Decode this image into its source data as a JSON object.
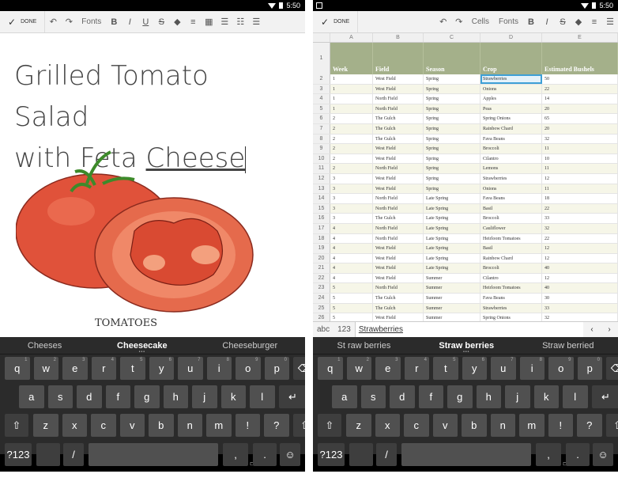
{
  "status_time": "5:50",
  "left": {
    "toolbar": {
      "done": "DONE",
      "fonts": "Fonts"
    },
    "doc_title_line1": "Grilled Tomato Salad",
    "doc_title_line2a": "with Feta ",
    "doc_title_line2b": "Cheese",
    "illus_label": "TOMATOES",
    "suggestions": [
      "Cheeses",
      "Cheesecake",
      "Cheeseburger"
    ]
  },
  "right": {
    "toolbar": {
      "done": "DONE",
      "cells": "Cells",
      "fonts": "Fonts"
    },
    "columns": [
      "A",
      "B",
      "C",
      "D",
      "E"
    ],
    "header_row": {
      "num": "1",
      "cells": [
        "Week",
        "Field",
        "Season",
        "Crop",
        "Estimated Bushels"
      ]
    },
    "rows": [
      [
        "2",
        "1",
        "West Field",
        "Spring",
        "Strawberries",
        "50"
      ],
      [
        "3",
        "1",
        "West Field",
        "Spring",
        "Onions",
        "22"
      ],
      [
        "4",
        "1",
        "North Field",
        "Spring",
        "Apples",
        "14"
      ],
      [
        "5",
        "1",
        "North Field",
        "Spring",
        "Peas",
        "20"
      ],
      [
        "6",
        "2",
        "The Gulch",
        "Spring",
        "Spring Onions",
        "65"
      ],
      [
        "7",
        "2",
        "The Gulch",
        "Spring",
        "Rainbow Chard",
        "20"
      ],
      [
        "8",
        "2",
        "The Gulch",
        "Spring",
        "Fava Beans",
        "32"
      ],
      [
        "9",
        "2",
        "West Field",
        "Spring",
        "Broccoli",
        "11"
      ],
      [
        "10",
        "2",
        "West Field",
        "Spring",
        "Cilantro",
        "10"
      ],
      [
        "11",
        "2",
        "North Field",
        "Spring",
        "Lemons",
        "11"
      ],
      [
        "12",
        "3",
        "West Field",
        "Spring",
        "Strawberries",
        "12"
      ],
      [
        "13",
        "3",
        "West Field",
        "Spring",
        "Onions",
        "11"
      ],
      [
        "14",
        "3",
        "North Field",
        "Late Spring",
        "Fava Beans",
        "18"
      ],
      [
        "15",
        "3",
        "North Field",
        "Late Spring",
        "Basil",
        "22"
      ],
      [
        "16",
        "3",
        "The Gulch",
        "Late Spring",
        "Broccoli",
        "33"
      ],
      [
        "17",
        "4",
        "North Field",
        "Late Spring",
        "Cauliflower",
        "32"
      ],
      [
        "18",
        "4",
        "North Field",
        "Late Spring",
        "Heirloom Tomatoes",
        "22"
      ],
      [
        "19",
        "4",
        "West Field",
        "Late Spring",
        "Basil",
        "12"
      ],
      [
        "20",
        "4",
        "West Field",
        "Late Spring",
        "Rainbow Chard",
        "12"
      ],
      [
        "21",
        "4",
        "West Field",
        "Late Spring",
        "Broccoli",
        "40"
      ],
      [
        "22",
        "4",
        "West Field",
        "Summer",
        "Cilantro",
        "12"
      ],
      [
        "23",
        "5",
        "North Field",
        "Summer",
        "Heirloom Tomatoes",
        "40"
      ],
      [
        "24",
        "5",
        "The Gulch",
        "Summer",
        "Fava Beans",
        "30"
      ],
      [
        "25",
        "5",
        "The Gulch",
        "Summer",
        "Strawberries",
        "33"
      ],
      [
        "26",
        "5",
        "West Field",
        "Summer",
        "Spring Onions",
        "32"
      ]
    ],
    "formula": {
      "abc": "abc",
      "num": "123",
      "value": "Strawberries",
      "prev": "‹",
      "next": "›"
    },
    "suggestions": [
      "St raw berries",
      "Straw berries",
      "Straw berried"
    ]
  },
  "keyboard": {
    "row1": [
      [
        "q",
        "1"
      ],
      [
        "w",
        "2"
      ],
      [
        "e",
        "3"
      ],
      [
        "r",
        "4"
      ],
      [
        "t",
        "5"
      ],
      [
        "y",
        "6"
      ],
      [
        "u",
        "7"
      ],
      [
        "i",
        "8"
      ],
      [
        "o",
        "9"
      ],
      [
        "p",
        "0"
      ]
    ],
    "row2": [
      "a",
      "s",
      "d",
      "f",
      "g",
      "h",
      "j",
      "k",
      "l"
    ],
    "row3": [
      "z",
      "x",
      "c",
      "v",
      "b",
      "n",
      "m",
      "!",
      "?"
    ],
    "sym": "?123",
    "comma": ",",
    "period": ".",
    "slash": "/",
    "emoji": "☺",
    "backspace": "⌫",
    "enter": "↵",
    "shift": "⇧"
  }
}
